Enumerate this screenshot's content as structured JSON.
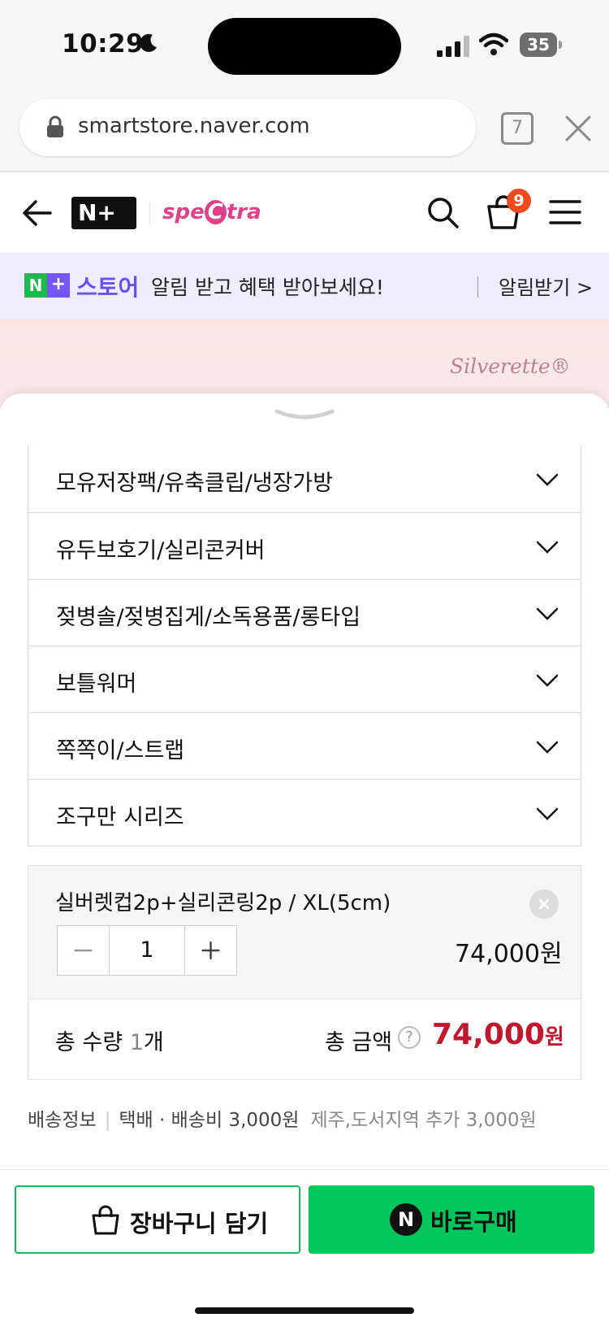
{
  "status_bar": {
    "time": "10:29",
    "battery": "35"
  },
  "browser": {
    "url": "smartstore.naver.com",
    "tab_count": "7"
  },
  "header": {
    "logo_text": "N+",
    "brand_prefix": "spe",
    "brand_c": "C",
    "brand_suffix": "tra",
    "cart_count": "9"
  },
  "promo": {
    "store_label": "스토어",
    "message": "알림 받고 혜택 받아보세요!",
    "link": "알림받기 >"
  },
  "hero": {
    "brand": "Silverette®"
  },
  "options": [
    {
      "label": "모유저장팩/유축클립/냉장가방"
    },
    {
      "label": "유두보호기/실리콘커버"
    },
    {
      "label": "젖병솔/젖병집게/소독용품/롱타입"
    },
    {
      "label": "보틀워머"
    },
    {
      "label": "쪽쪽이/스트랩"
    },
    {
      "label": "조구만 시리즈"
    }
  ],
  "selected_item": {
    "name": "실버렛컵2p+실리콘링2p / XL(5cm)",
    "quantity": "1",
    "price": "74,000원"
  },
  "summary": {
    "qty_label": "총 수량 ",
    "qty_value": "1",
    "qty_unit": "개",
    "amount_label": "총 금액",
    "help": "?",
    "amount": "74,000",
    "amount_unit": "원"
  },
  "shipping": {
    "label": "배송정보",
    "sep": "|",
    "info": "택배 · 배송비 3,000원",
    "extra": "제주,도서지역 추가 3,000원"
  },
  "buttons": {
    "cart": "장바구니 담기",
    "buy": "바로구매",
    "buy_icon": "N"
  },
  "colors": {
    "accent_green": "#03c75a",
    "price_red": "#c0182f",
    "promo_purple": "#6a4ff2",
    "badge_orange": "#f04a1d"
  }
}
